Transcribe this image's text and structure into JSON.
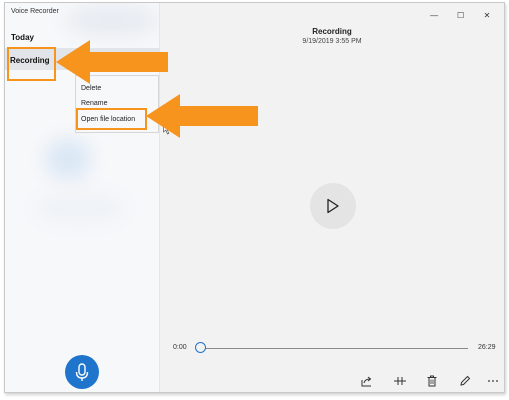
{
  "window": {
    "title": "Voice Recorder",
    "controls": {
      "minimize": "—",
      "maximize": "☐",
      "close": "✕"
    }
  },
  "sidebar": {
    "group_header": "Today",
    "recording_item": "Recording",
    "context_menu": [
      "Delete",
      "Rename",
      "Open file location"
    ],
    "record_button_icon": "microphone-icon"
  },
  "player": {
    "title": "Recording",
    "date": "9/19/2019 3:55 PM",
    "time_start": "0:00",
    "time_end": "26:29",
    "progress": 0,
    "toolbar_icons": [
      "share-icon",
      "trim-icon",
      "delete-icon",
      "edit-icon",
      "more-icon"
    ]
  },
  "annotation": {
    "highlight_color": "#f7941d"
  },
  "colors": {
    "accent": "#1f75cc",
    "sidebar_bg": "#f7f8fa",
    "main_bg": "#f2f2f2"
  }
}
